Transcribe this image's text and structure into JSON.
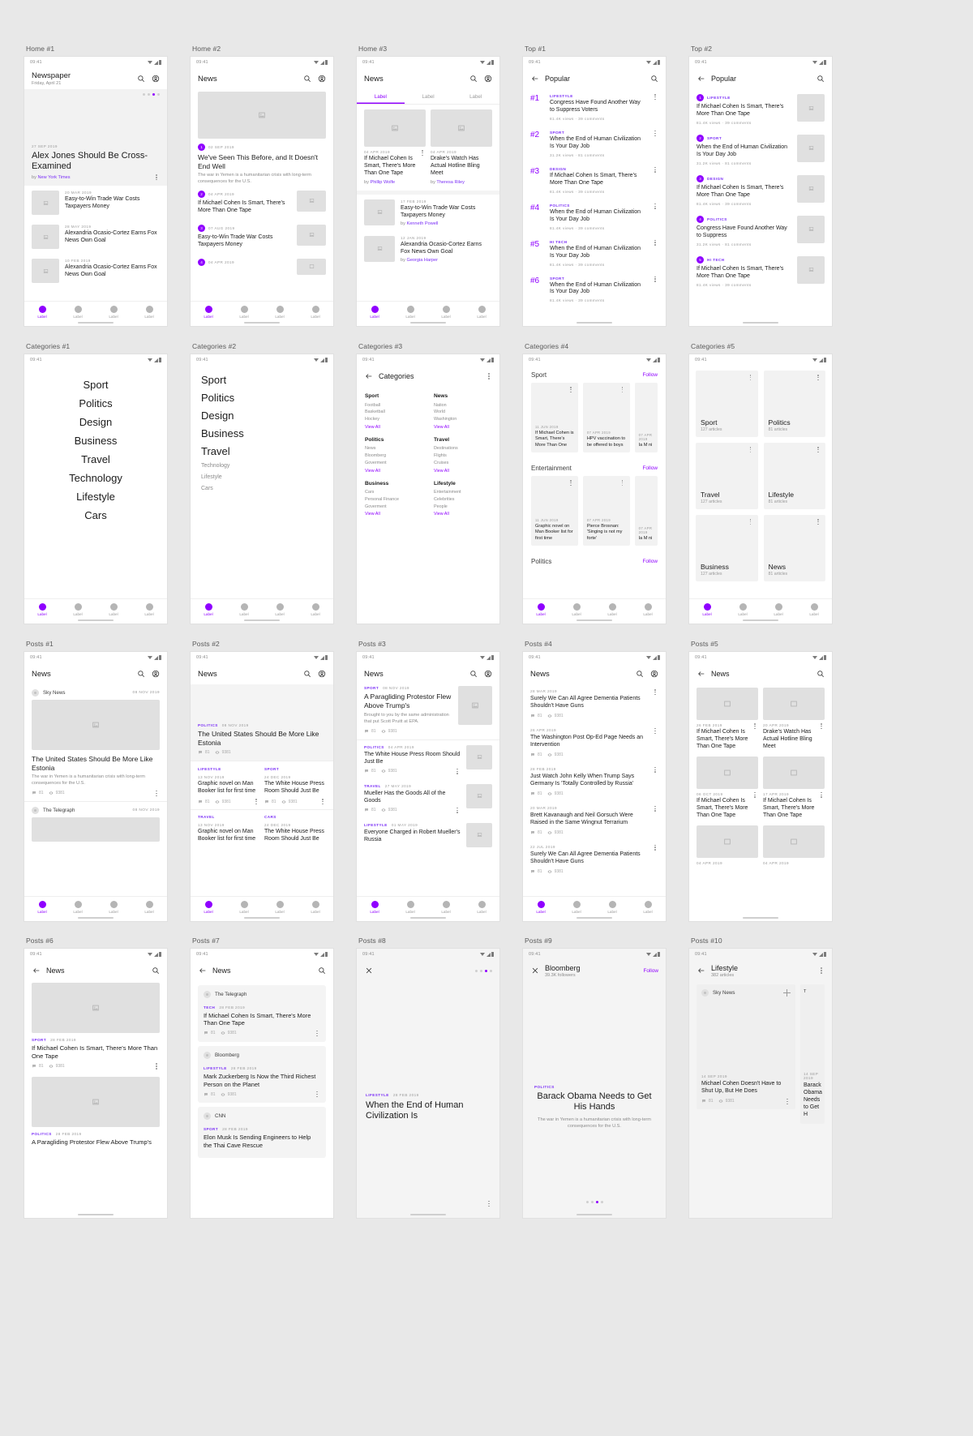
{
  "meta": {
    "status_time": "09:41",
    "accent": "#8f00ff",
    "muted": "#9a9a9a"
  },
  "nav": {
    "labels": [
      "Label",
      "Label",
      "Label",
      "Label"
    ]
  },
  "frames": {
    "home1": {
      "label": "Home #1",
      "title": "Newspaper",
      "subtitle": "Friday, April 21",
      "hero": {
        "date": "27 SEP 2019",
        "title": "Alex Jones Should Be Cross-Examined",
        "by_prefix": "by ",
        "by": "New York Times"
      },
      "list": [
        {
          "date": "20 MAR 2019",
          "title": "Easy-to-Win Trade War Costs Taxpayers Money"
        },
        {
          "date": "28 MAY 2019",
          "title": "Alexandria Ocasio-Cortez Earns Fox News Own Goal"
        },
        {
          "date": "10 FEB 2019",
          "title": "Alexandria Ocasio-Cortez Earns Fox News Own Goal"
        }
      ]
    },
    "home2": {
      "label": "Home #2",
      "title": "News",
      "hero": {
        "num": "1",
        "date": "02 SEP 2019",
        "title": "We've Seen This Before, and It Doesn't End Well",
        "desc": "The war in Yemen is a humanitarian crisis with long-term consequences for the U.S."
      },
      "list": [
        {
          "num": "2",
          "date": "04 APR 2019",
          "title": "If Michael Cohen Is Smart, There's More Than One Tape"
        },
        {
          "num": "3",
          "date": "07 AUG 2019",
          "title": "Easy-to-Win Trade War Costs Taxpayers Money"
        },
        {
          "num": "4",
          "date": "04 APR 2019",
          "title": "If Michael Cohen Is Smart, There's More"
        }
      ]
    },
    "home3": {
      "label": "Home #3",
      "title": "News",
      "tabs": [
        "Label",
        "Label",
        "Label"
      ],
      "cards": [
        {
          "date": "04 APR 2019",
          "title": "If Michael Cohen Is Smart, There's More Than One Tape",
          "by_prefix": "by ",
          "by": "Phillip Wolfe"
        },
        {
          "date": "04 APR 2019",
          "title": "Drake's Watch Has Actual Hotline Bling Meet",
          "by_prefix": "by ",
          "by": "Theresa Riley"
        }
      ],
      "list": [
        {
          "date": "17 FEB 2019",
          "title": "Easy-to-Win Trade War Costs Taxpayers Money",
          "by_prefix": "by ",
          "by": "Kenneth Powell"
        },
        {
          "date": "12 JAN 2019",
          "title": "Alexandria Ocasio-Cortez Earns Fox News Own Goal",
          "by_prefix": "by ",
          "by": "Georgia Harper"
        }
      ]
    },
    "top1": {
      "label": "Top #1",
      "title": "Popular",
      "items": [
        {
          "rank": "#1",
          "cat": "LIFESTYLE",
          "title": "Congress Have Found Another Way to Suppress Voters",
          "stats": "81.4K views · 39 comments"
        },
        {
          "rank": "#2",
          "cat": "SPORT",
          "title": "When the End of Human Civilization Is Your Day Job",
          "stats": "31.2K views · 81 comments"
        },
        {
          "rank": "#3",
          "cat": "DESIGN",
          "title": "If Michael Cohen Is Smart, There's More Than One Tape",
          "stats": "81.4K views · 39 comments"
        },
        {
          "rank": "#4",
          "cat": "POLITICS",
          "title": "When the End of Human Civilization Is Your Day Job",
          "stats": "81.4K views · 39 comments"
        },
        {
          "rank": "#5",
          "cat": "HI TECH",
          "title": "When the End of Human Civilization Is Your Day Job",
          "stats": "81.4K views · 39 comments"
        },
        {
          "rank": "#6",
          "cat": "SPORT",
          "title": "When the End of Human Civilization Is Your Day Job",
          "stats": "81.4K views · 39 comments"
        }
      ]
    },
    "top2": {
      "label": "Top #2",
      "title": "Popular",
      "items": [
        {
          "num": "1",
          "cat": "LIFESTYLE",
          "title": "If Michael Cohen Is Smart, There's More Than One Tape",
          "stats": "81.4K views · 39 comments"
        },
        {
          "num": "2",
          "cat": "SPORT",
          "title": "When the End of Human Civilization Is Your Day Job",
          "stats": "31.2K views · 81 comments"
        },
        {
          "num": "3",
          "cat": "DESIGN",
          "title": "If Michael Cohen Is Smart, There's More Than One Tape",
          "stats": "81.4K views · 39 comments"
        },
        {
          "num": "4",
          "cat": "POLITICS",
          "title": "Congress Have Found Another Way to Suppress",
          "stats": "31.2K views · 81 comments"
        },
        {
          "num": "5",
          "cat": "HI TECH",
          "title": "If Michael Cohen Is Smart, There's More Than One Tape",
          "stats": "81.4K views · 39 comments"
        }
      ]
    },
    "cat1": {
      "label": "Categories #1",
      "items": [
        "Sport",
        "Politics",
        "Design",
        "Business",
        "Travel",
        "Technology",
        "Lifestyle",
        "Cars"
      ]
    },
    "cat2": {
      "label": "Categories #2",
      "items": [
        {
          "name": "Sport",
          "size": "big"
        },
        {
          "name": "Politics",
          "size": "big"
        },
        {
          "name": "Design",
          "size": "big"
        },
        {
          "name": "Business",
          "size": "big"
        },
        {
          "name": "Travel",
          "size": "big"
        },
        {
          "name": "Technology",
          "size": "small"
        },
        {
          "name": "Lifestyle",
          "size": "small"
        },
        {
          "name": "Cars",
          "size": "small"
        }
      ]
    },
    "cat3": {
      "label": "Categories #3",
      "title": "Categories",
      "view_all": "View All",
      "columns": [
        [
          {
            "head": "Sport",
            "items": [
              "Football",
              "Basketball",
              "Hockey"
            ]
          },
          {
            "head": "Politics",
            "items": [
              "News",
              "Bloomberg",
              "Goverment"
            ]
          },
          {
            "head": "Business",
            "items": [
              "Cars",
              "Personal Finance",
              "Goverment"
            ]
          }
        ],
        [
          {
            "head": "News",
            "items": [
              "Nation",
              "World",
              "Washington"
            ]
          },
          {
            "head": "Travel",
            "items": [
              "Destinations",
              "Flights",
              "Cruises"
            ]
          },
          {
            "head": "Lifestyle",
            "items": [
              "Entertainment",
              "Celebrities",
              "People"
            ]
          }
        ]
      ]
    },
    "cat4": {
      "label": "Categories #4",
      "follow": "Follow",
      "sections": [
        {
          "head": "Sport",
          "cards": [
            {
              "date": "11 JUN 2019",
              "title": "If Michael Cohen is Smart, There's More Than One"
            },
            {
              "date": "07 APR 2019",
              "title": "HPV vaccination to be offered to boys"
            },
            {
              "date": "07 APR 2019",
              "title": "Ia M ni"
            }
          ]
        },
        {
          "head": "Entertainment",
          "cards": [
            {
              "date": "11 JUN 2019",
              "title": "Graphic novel on Man Booker list for first time"
            },
            {
              "date": "07 APR 2019",
              "title": "Pierce Brosnan: 'Singing is not my forte'"
            },
            {
              "date": "07 APR 2019",
              "title": "Ia M ni"
            }
          ]
        },
        {
          "head": "Politics",
          "cards": []
        }
      ]
    },
    "cat5": {
      "label": "Categories #5",
      "tiles": [
        {
          "name": "Sport",
          "count": "127 articles"
        },
        {
          "name": "Politics",
          "count": "81 articles"
        },
        {
          "name": "Travel",
          "count": "127 articles"
        },
        {
          "name": "Lifestyle",
          "count": "81 articles"
        },
        {
          "name": "Business",
          "count": "127 articles"
        },
        {
          "name": "News",
          "count": "81 articles"
        }
      ]
    },
    "posts1": {
      "label": "Posts #1",
      "title": "News",
      "posts": [
        {
          "source": "Sky News",
          "date": "08 NOV 2019",
          "title": "The United States Should Be More Like Estonia",
          "desc": "The war in Yemen is a humanitarian crisis with long-term consequences for the U.S.",
          "comments": "81",
          "views": "9381"
        },
        {
          "source": "The Telegraph",
          "date": "08 NOV 2019"
        }
      ]
    },
    "posts2": {
      "label": "Posts #2",
      "title": "News",
      "hero": {
        "cat": "POLITICS",
        "date": "08 NOV 2019",
        "title": "The United States Should Be More Like Estonia",
        "comments": "81",
        "views": "9381"
      },
      "grid": [
        {
          "cat": "LIFESTYLE",
          "date": "13 NOV 2019",
          "title": "Graphic novel on Man Booker list for first time",
          "comments": "81",
          "views": "9381"
        },
        {
          "cat": "SPORT",
          "date": "24 DEC 2019",
          "title": "The White House Press Room Should Just Be",
          "comments": "81",
          "views": "9381"
        },
        {
          "cat": "TRAVEL",
          "date": "13 NOV 2019",
          "title": "Graphic novel on Man Booker list for first time",
          "comments": "81",
          "views": "9381"
        },
        {
          "cat": "CARS",
          "date": "24 DEC 2019",
          "title": "The White House Press Room Should Just Be",
          "comments": "81",
          "views": "9381"
        }
      ]
    },
    "posts3": {
      "label": "Posts #3",
      "title": "News",
      "hero": {
        "cat": "SPORT",
        "date": "08 NOV 2019",
        "title": "A Paragliding Protestor Flew Above Trump's",
        "desc": "Brought to you by the same administration that put Scott Pruitt at EPA.",
        "comments": "81",
        "views": "9381"
      },
      "list": [
        {
          "cat": "POLITICS",
          "date": "04 APR 2019",
          "title": "The White House Press Room Should Just Be",
          "comments": "81",
          "views": "9381"
        },
        {
          "cat": "TRAVEL",
          "date": "27 MAY 2019",
          "title": "Mueller Has the Goods All of the Goods",
          "comments": "81",
          "views": "9381"
        },
        {
          "cat": "LIFESTYLE",
          "date": "01 MAY 2019",
          "title": "Everyone Charged in Robert Mueller's Russia",
          "comments": "81",
          "views": "9381"
        }
      ]
    },
    "posts4": {
      "label": "Posts #4",
      "title": "News",
      "list": [
        {
          "date": "28 MAR 2019",
          "title": "Surely We Can All Agree Dementia Patients Shouldn't Have Guns",
          "comments": "81",
          "views": "9381"
        },
        {
          "date": "26 APR 2019",
          "title": "The Washington Post Op-Ed Page Needs an Intervention",
          "comments": "81",
          "views": "9381"
        },
        {
          "date": "28 FEB 2019",
          "title": "Just Watch John Kelly When Trump Says Germany Is 'Totally Controlled by Russia'",
          "comments": "81",
          "views": "9381"
        },
        {
          "date": "20 MAR 2019",
          "title": "Brett Kavanaugh and Neil Gorsuch Were Raised in the Same Wingnut Terrarium",
          "comments": "81",
          "views": "9381"
        },
        {
          "date": "22 JUL 2019",
          "title": "Surely We Can All Agree Dementia Patients Shouldn't Have Guns",
          "comments": "81",
          "views": "9381"
        }
      ]
    },
    "posts5": {
      "label": "Posts #5",
      "title": "News",
      "grid": [
        {
          "date": "26 FEB 2019",
          "title": "If Michael Cohen Is Smart, There's More Than One Tape"
        },
        {
          "date": "20 APR 2019",
          "title": "Drake's Watch Has Actual Hotline Bling Meet"
        },
        {
          "date": "06 OCT 2019",
          "title": "If Michael Cohen Is Smart, There's More Than One Tape"
        },
        {
          "date": "17 APR 2019",
          "title": "If Michael Cohen Is Smart, There's More Than One Tape"
        },
        {
          "date": "04 APR 2019",
          "title": ""
        },
        {
          "date": "04 APR 2019",
          "title": ""
        }
      ]
    },
    "posts6": {
      "label": "Posts #6",
      "title": "News",
      "posts": [
        {
          "cat": "SPORT",
          "date": "28 FEB 2019",
          "title": "If Michael Cohen Is Smart, There's More Than One Tape",
          "comments": "81",
          "views": "9381"
        },
        {
          "cat": "POLITICS",
          "date": "28 FEB 2019",
          "title": "A Paragliding Protestor Flew Above Trump's",
          "comments": "81",
          "views": "9381"
        }
      ]
    },
    "posts7": {
      "label": "Posts #7",
      "title": "News",
      "cards": [
        {
          "source": "The Telegraph",
          "cat": "TECH",
          "date": "28 FEB 2019",
          "title": "If Michael Cohen Is Smart, There's More Than One Tape",
          "comments": "81",
          "views": "9381"
        },
        {
          "source": "Bloomberg",
          "cat": "LIFESTYLE",
          "date": "28 FEB 2019",
          "title": "Mark Zuckerberg Is Now the Third Richest Person on the Planet",
          "comments": "81",
          "views": "9381"
        },
        {
          "source": "CNN",
          "cat": "SPORT",
          "date": "28 FEB 2019",
          "title": "Elon Musk Is Sending Engineers to Help the Thai Cave Rescue",
          "comments": "81",
          "views": "9381"
        }
      ]
    },
    "posts8": {
      "label": "Posts #8",
      "cat": "LIFESTYLE",
      "date": "28 FEB 2019",
      "title": "When the End of Human Civilization Is"
    },
    "posts9": {
      "label": "Posts #9",
      "source": "Bloomberg",
      "followers": "39.3K followers",
      "follow": "Follow",
      "cat": "POLITICS",
      "date": "26 FEB 2019",
      "title": "Barack Obama Needs to Get His Hands",
      "desc": "The war in Yemen is a humanitarian crisis with long-term consequences for the U.S."
    },
    "posts10": {
      "label": "Posts #10",
      "title": "Lifestyle",
      "subtitle": "382 articles",
      "source": "Sky News",
      "items": [
        {
          "date": "14 SEP 2019",
          "title": "Michael Cohen Doesn't Have to Shut Up, But He Does",
          "comments": "81",
          "views": "9381"
        },
        {
          "date": "14 SEP 2019",
          "title": "Barack Obama Needs to Get H"
        }
      ]
    }
  }
}
